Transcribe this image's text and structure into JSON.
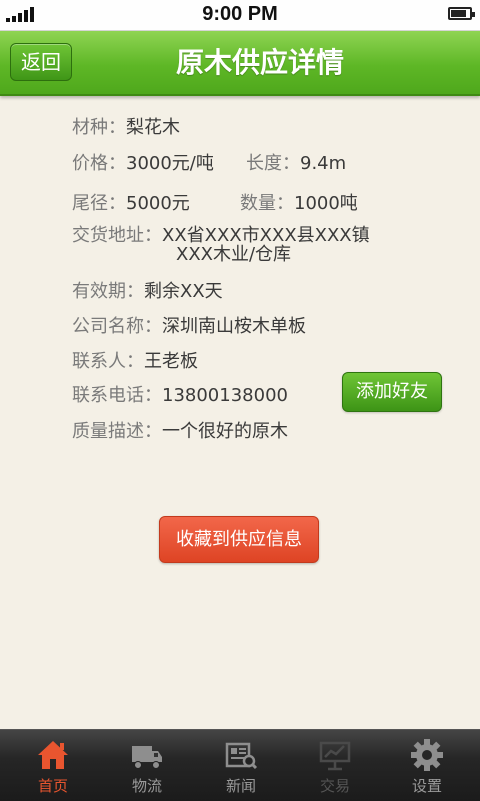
{
  "status_bar": {
    "time": "9:00 PM",
    "signal_bars": 5,
    "battery_level": 0.85
  },
  "header": {
    "back_label": "返回",
    "title": "原木供应详情"
  },
  "details": {
    "species": {
      "label": "材种：",
      "value": "梨花木"
    },
    "price": {
      "label": "价格：",
      "value": "3000元/吨"
    },
    "length": {
      "label": "长度：",
      "value": "9.4m"
    },
    "tail_diameter": {
      "label": "尾径：",
      "value": "5000元"
    },
    "quantity": {
      "label": "数量：",
      "value": "1000吨"
    },
    "address": {
      "label": "交货地址：",
      "line1": "XX省XXX市XXX县XXX镇",
      "line2": "XXX木业/仓库"
    },
    "validity": {
      "label": "有效期：",
      "value": "剩余XX天"
    },
    "company": {
      "label": "公司名称：",
      "value": "深圳南山桉木单板"
    },
    "contact": {
      "label": "联系人：",
      "value": "王老板"
    },
    "phone": {
      "label": "联系电话：",
      "value": "13800138000"
    },
    "quality": {
      "label": "质量描述：",
      "value": "一个很好的原木"
    }
  },
  "buttons": {
    "add_friend": "添加好友",
    "favorite": "收藏到供应信息"
  },
  "tabbar": {
    "tabs": [
      {
        "label": "首页",
        "icon": "home-icon",
        "state": "active"
      },
      {
        "label": "物流",
        "icon": "truck-icon",
        "state": "normal"
      },
      {
        "label": "新闻",
        "icon": "news-icon",
        "state": "normal"
      },
      {
        "label": "交易",
        "icon": "trade-icon",
        "state": "disabled"
      },
      {
        "label": "设置",
        "icon": "gear-icon",
        "state": "normal"
      }
    ]
  },
  "colors": {
    "header_green": "#5eb726",
    "accent_red": "#e8552f",
    "background": "#f4f0e6"
  }
}
